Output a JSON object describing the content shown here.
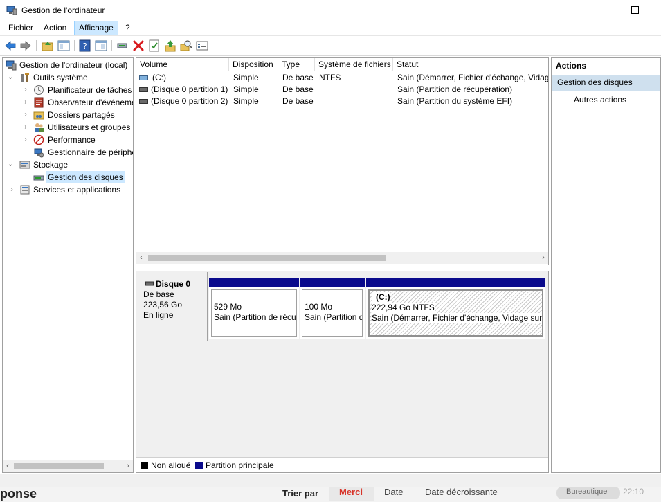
{
  "window": {
    "title": "Gestion de l'ordinateur",
    "icon": "computer-management-icon"
  },
  "menu": {
    "items": [
      "Fichier",
      "Action",
      "Affichage",
      "?"
    ],
    "active": "Affichage"
  },
  "toolbar": {
    "icons": [
      "back-arrow-icon",
      "forward-arrow-icon",
      "up-folder-icon",
      "show-hide-tree-icon",
      "help-icon",
      "properties-icon",
      "connect-icon",
      "delete-icon",
      "check-icon",
      "import-icon",
      "search-icon",
      "list-icon"
    ]
  },
  "tree": {
    "items": [
      {
        "label": "Gestion de l'ordinateur (local)",
        "icon": "computer-icon",
        "level": 0,
        "chevron": ""
      },
      {
        "label": "Outils système",
        "icon": "tools-icon",
        "level": 1,
        "chevron": "expanded"
      },
      {
        "label": "Planificateur de tâches",
        "icon": "clock-icon",
        "level": 2,
        "chevron": "collapsed"
      },
      {
        "label": "Observateur d'événements",
        "icon": "event-viewer-icon",
        "level": 2,
        "chevron": "collapsed"
      },
      {
        "label": "Dossiers partagés",
        "icon": "shared-folder-icon",
        "level": 2,
        "chevron": "collapsed"
      },
      {
        "label": "Utilisateurs et groupes locaux",
        "icon": "users-icon",
        "level": 2,
        "chevron": "collapsed"
      },
      {
        "label": "Performance",
        "icon": "performance-icon",
        "level": 2,
        "chevron": "collapsed"
      },
      {
        "label": "Gestionnaire de périphériques",
        "icon": "device-manager-icon",
        "level": 2,
        "chevron": ""
      },
      {
        "label": "Stockage",
        "icon": "storage-icon",
        "level": 1,
        "chevron": "expanded"
      },
      {
        "label": "Gestion des disques",
        "icon": "disk-icon",
        "level": 2,
        "chevron": "",
        "selected": true
      },
      {
        "label": "Services et applications",
        "icon": "services-icon",
        "level": 1,
        "chevron": "collapsed"
      }
    ]
  },
  "volumes": {
    "columns": [
      "Volume",
      "Disposition",
      "Type",
      "Système de fichiers",
      "Statut"
    ],
    "rows": [
      {
        "volume": "(C:)",
        "disposition": "Simple",
        "type": "De base",
        "fs": "NTFS",
        "statut": "Sain (Démarrer, Fichier d'échange, Vidage sur incident, Partition principale)"
      },
      {
        "volume": "(Disque 0 partition 1)",
        "disposition": "Simple",
        "type": "De base",
        "fs": "",
        "statut": "Sain (Partition de récupération)"
      },
      {
        "volume": "(Disque 0 partition 2)",
        "disposition": "Simple",
        "type": "De base",
        "fs": "",
        "statut": "Sain (Partition du système EFI)"
      }
    ]
  },
  "disk": {
    "name": "Disque 0",
    "type": "De base",
    "size": "223,56 Go",
    "state": "En ligne",
    "partitions": [
      {
        "title": "",
        "size": "529 Mo",
        "status": "Sain (Partition de récupération)"
      },
      {
        "title": "",
        "size": "100 Mo",
        "status": "Sain (Partition du système EFI)"
      },
      {
        "title": "(C:)",
        "size": "222,94 Go NTFS",
        "status": "Sain (Démarrer, Fichier d'échange, Vidage sur incident, Partition principale)"
      }
    ]
  },
  "legend": {
    "items": [
      {
        "label": "Non alloué",
        "color": "#000000"
      },
      {
        "label": "Partition principale",
        "color": "#0a0a8c"
      }
    ]
  },
  "actions": {
    "title": "Actions",
    "section": "Gestion des disques",
    "item": "Autres actions"
  },
  "background": {
    "texts": [
      "ponse",
      "Trier par",
      "Merci",
      "Date",
      "Date décroissante",
      "Bureautique",
      "22:10"
    ]
  }
}
